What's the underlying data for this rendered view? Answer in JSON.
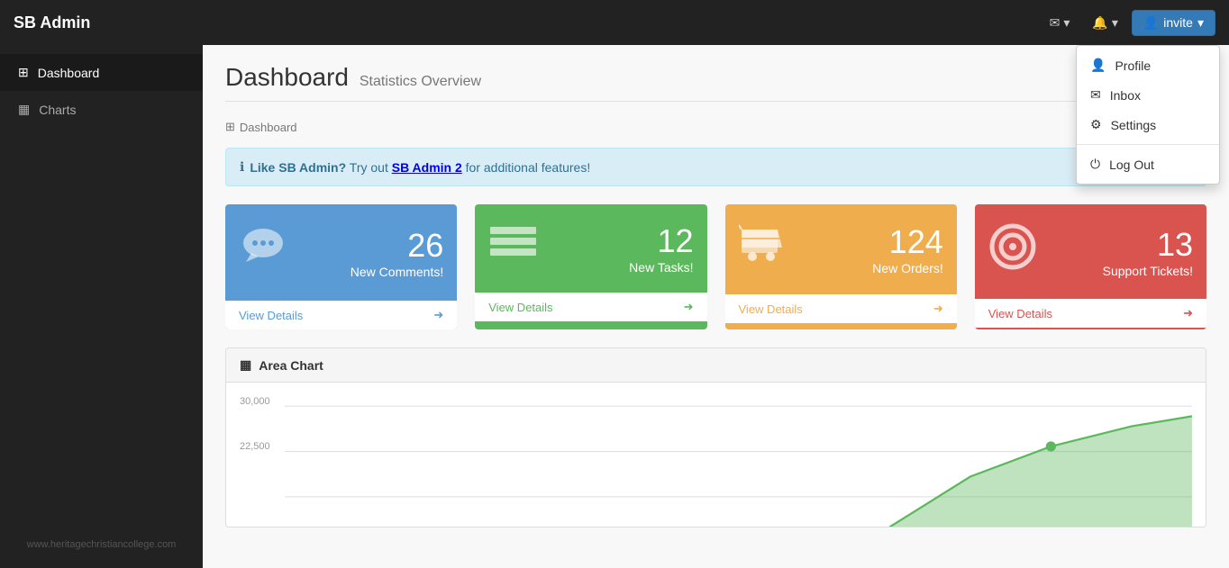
{
  "app": {
    "title": "SB Admin"
  },
  "navbar": {
    "brand": "SB Admin",
    "mail_icon": "✉",
    "bell_icon": "🔔",
    "invite_label": "invite",
    "caret": "▾"
  },
  "sidebar": {
    "items": [
      {
        "id": "dashboard",
        "icon": "⊞",
        "label": "Dashboard",
        "active": true
      },
      {
        "id": "charts",
        "icon": "▦",
        "label": "Charts",
        "active": false
      }
    ],
    "footer": "www.heritagechristiancollege.com"
  },
  "page": {
    "title": "Dashboard",
    "subtitle": "Statistics Overview",
    "breadcrumb_icon": "⊞",
    "breadcrumb_label": "Dashboard"
  },
  "alert": {
    "icon": "ℹ",
    "text_start": "Like SB Admin?",
    "text_mid": " Try out ",
    "link_text": "SB Admin 2",
    "text_end": " for additional features!"
  },
  "stat_cards": [
    {
      "id": "comments",
      "color": "blue",
      "icon": "💬",
      "count": "26",
      "label": "New Comments!",
      "link": "View Details",
      "arrow": "➜"
    },
    {
      "id": "tasks",
      "color": "green",
      "icon": "☰",
      "count": "12",
      "label": "New Tasks!",
      "link": "View Details",
      "arrow": "➜"
    },
    {
      "id": "orders",
      "color": "yellow",
      "icon": "🛒",
      "count": "124",
      "label": "New Orders!",
      "link": "View Details",
      "arrow": "➜"
    },
    {
      "id": "tickets",
      "color": "red",
      "icon": "⊕",
      "count": "13",
      "label": "Support Tickets!",
      "link": "View Details",
      "arrow": "➜"
    }
  ],
  "area_chart": {
    "title": "Area Chart",
    "icon": "▦",
    "y_labels": [
      "30,000",
      "22,500"
    ],
    "accent_color": "#5cb85c"
  },
  "dropdown_menu": {
    "items": [
      {
        "id": "profile",
        "icon": "👤",
        "label": "Profile"
      },
      {
        "id": "inbox",
        "icon": "✉",
        "label": "Inbox"
      },
      {
        "id": "settings",
        "icon": "⚙",
        "label": "Settings"
      },
      {
        "id": "logout",
        "icon": "⏻",
        "label": "Log Out"
      }
    ]
  }
}
